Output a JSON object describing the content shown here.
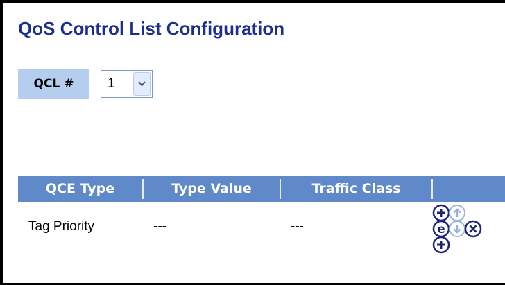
{
  "page": {
    "title": "QoS Control List Configuration"
  },
  "qcl": {
    "label": "QCL #",
    "selected": "1"
  },
  "table": {
    "columns": [
      "QCE Type",
      "Type Value",
      "Traffic Class",
      ""
    ],
    "rows": [
      {
        "qce_type": "Tag Priority",
        "type_value": "---",
        "traffic_class": "---"
      }
    ]
  },
  "actions": {
    "insert_before": "plus-circle-icon",
    "move_up": "arrow-up-circle-icon",
    "edit": "edit-circle-icon",
    "move_down": "arrow-down-circle-icon",
    "delete": "x-circle-icon",
    "insert_after": "plus-circle-icon"
  },
  "colors": {
    "title": "#1c2f8c",
    "header_bg": "#5f89c8",
    "label_bg": "#b5ceef",
    "icon": "#1c2478",
    "icon_disabled": "#9ab3dd"
  }
}
